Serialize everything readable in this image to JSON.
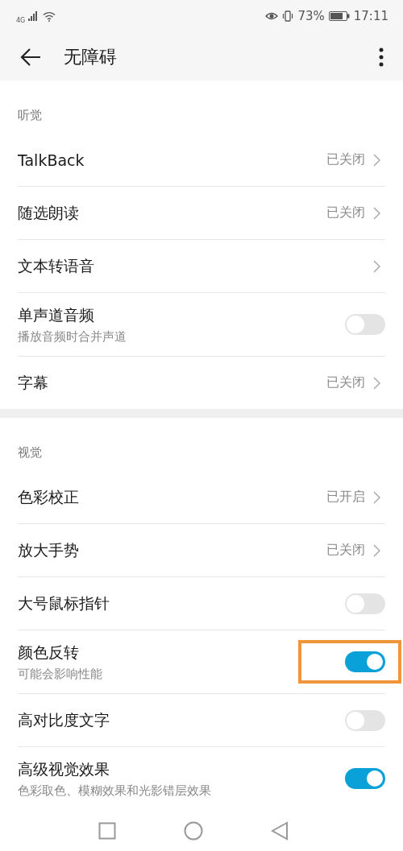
{
  "status_bar": {
    "network": "4G",
    "battery": "73%",
    "time": "17:11"
  },
  "app_bar": {
    "title": "无障碍"
  },
  "sections": [
    {
      "title": "听觉",
      "items": [
        {
          "kind": "link",
          "label": "TalkBack",
          "value": "已关闭"
        },
        {
          "kind": "link",
          "label": "随选朗读",
          "value": "已关闭"
        },
        {
          "kind": "link",
          "label": "文本转语音"
        },
        {
          "kind": "toggle",
          "label": "单声道音频",
          "subtitle": "播放音频时合并声道",
          "on": false,
          "highlighted": false
        },
        {
          "kind": "link",
          "label": "字幕",
          "value": "已关闭"
        }
      ]
    },
    {
      "title": "视觉",
      "items": [
        {
          "kind": "link",
          "label": "色彩校正",
          "value": "已开启"
        },
        {
          "kind": "link",
          "label": "放大手势",
          "value": "已关闭"
        },
        {
          "kind": "toggle",
          "label": "大号鼠标指针",
          "on": false,
          "highlighted": false
        },
        {
          "kind": "toggle",
          "label": "颜色反转",
          "subtitle": "可能会影响性能",
          "on": true,
          "highlighted": true
        },
        {
          "kind": "toggle",
          "label": "高对比度文字",
          "on": false,
          "highlighted": false
        },
        {
          "kind": "toggle",
          "label": "高级视觉效果",
          "subtitle": "色彩取色、模糊效果和光影错层效果",
          "on": true,
          "highlighted": false
        }
      ]
    }
  ]
}
